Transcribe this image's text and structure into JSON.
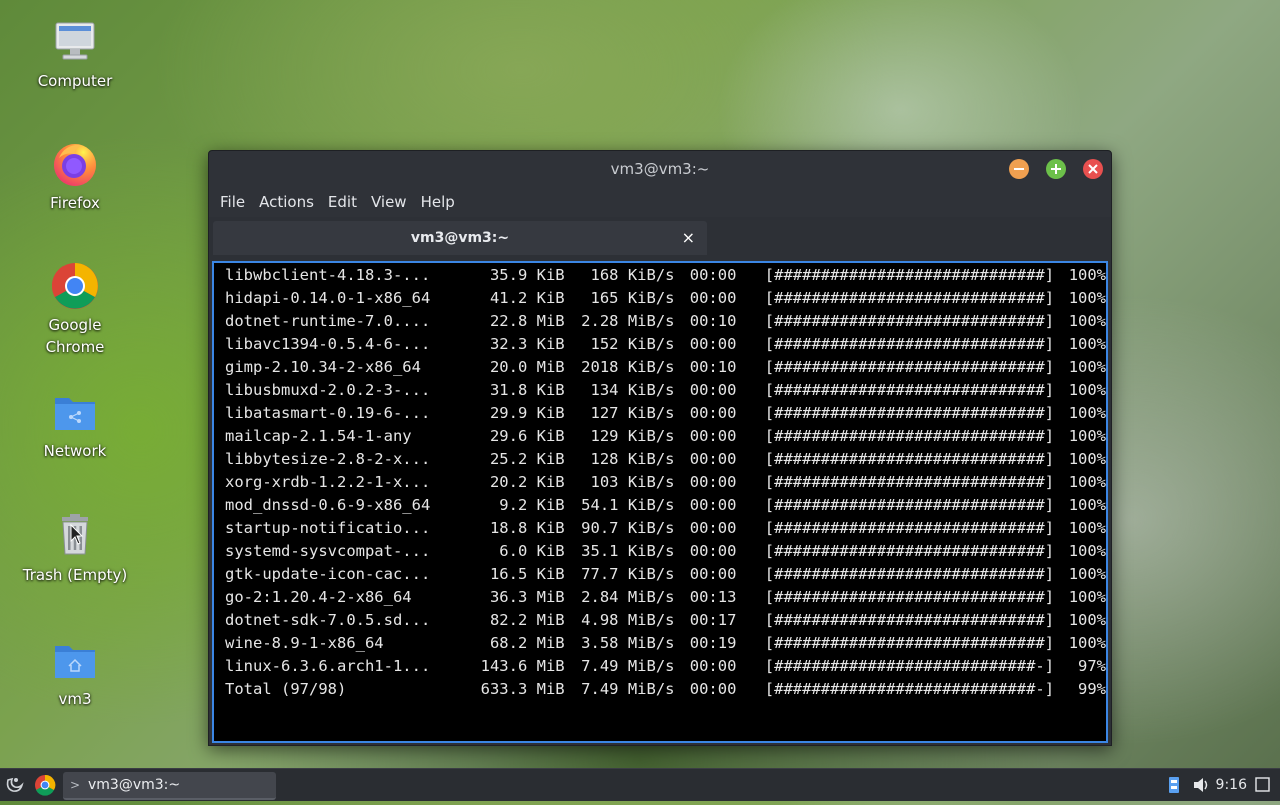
{
  "desktop": {
    "icons": [
      {
        "label": "Computer",
        "icon": "computer-icon"
      },
      {
        "label": "Firefox",
        "icon": "firefox-icon"
      },
      {
        "label": "Google Chrome",
        "icon": "chrome-icon"
      },
      {
        "label": "Network",
        "icon": "network-folder-icon"
      },
      {
        "label": "Trash (Empty)",
        "icon": "trash-icon"
      },
      {
        "label": "vm3",
        "icon": "home-folder-icon"
      }
    ]
  },
  "window": {
    "title": "vm3@vm3:~",
    "menu": [
      "File",
      "Actions",
      "Edit",
      "View",
      "Help"
    ],
    "tab": {
      "label": "vm3@vm3:~",
      "close": "×"
    },
    "colors": {
      "minimize": "#f0a050",
      "maximize": "#6cc04a",
      "close": "#e8504f",
      "focus_border": "#3b86e4"
    }
  },
  "terminal": {
    "rows": [
      {
        "name": "libwbclient-4.18.3-...",
        "size": "35.9 KiB",
        "rate": "168 KiB/s",
        "time": "00:00",
        "bar": "[#############################]",
        "pct": "100%"
      },
      {
        "name": "hidapi-0.14.0-1-x86_64",
        "size": "41.2 KiB",
        "rate": "165 KiB/s",
        "time": "00:00",
        "bar": "[#############################]",
        "pct": "100%"
      },
      {
        "name": "dotnet-runtime-7.0....",
        "size": "22.8 MiB",
        "rate": "2.28 MiB/s",
        "time": "00:10",
        "bar": "[#############################]",
        "pct": "100%"
      },
      {
        "name": "libavc1394-0.5.4-6-...",
        "size": "32.3 KiB",
        "rate": "152 KiB/s",
        "time": "00:00",
        "bar": "[#############################]",
        "pct": "100%"
      },
      {
        "name": "gimp-2.10.34-2-x86_64",
        "size": "20.0 MiB",
        "rate": "2018 KiB/s",
        "time": "00:10",
        "bar": "[#############################]",
        "pct": "100%"
      },
      {
        "name": "libusbmuxd-2.0.2-3-...",
        "size": "31.8 KiB",
        "rate": "134 KiB/s",
        "time": "00:00",
        "bar": "[#############################]",
        "pct": "100%"
      },
      {
        "name": "libatasmart-0.19-6-...",
        "size": "29.9 KiB",
        "rate": "127 KiB/s",
        "time": "00:00",
        "bar": "[#############################]",
        "pct": "100%"
      },
      {
        "name": "mailcap-2.1.54-1-any",
        "size": "29.6 KiB",
        "rate": "129 KiB/s",
        "time": "00:00",
        "bar": "[#############################]",
        "pct": "100%"
      },
      {
        "name": "libbytesize-2.8-2-x...",
        "size": "25.2 KiB",
        "rate": "128 KiB/s",
        "time": "00:00",
        "bar": "[#############################]",
        "pct": "100%"
      },
      {
        "name": "xorg-xrdb-1.2.2-1-x...",
        "size": "20.2 KiB",
        "rate": "103 KiB/s",
        "time": "00:00",
        "bar": "[#############################]",
        "pct": "100%"
      },
      {
        "name": "mod_dnssd-0.6-9-x86_64",
        "size": "9.2 KiB",
        "rate": "54.1 KiB/s",
        "time": "00:00",
        "bar": "[#############################]",
        "pct": "100%"
      },
      {
        "name": "startup-notificatio...",
        "size": "18.8 KiB",
        "rate": "90.7 KiB/s",
        "time": "00:00",
        "bar": "[#############################]",
        "pct": "100%"
      },
      {
        "name": "systemd-sysvcompat-...",
        "size": "6.0 KiB",
        "rate": "35.1 KiB/s",
        "time": "00:00",
        "bar": "[#############################]",
        "pct": "100%"
      },
      {
        "name": "gtk-update-icon-cac...",
        "size": "16.5 KiB",
        "rate": "77.7 KiB/s",
        "time": "00:00",
        "bar": "[#############################]",
        "pct": "100%"
      },
      {
        "name": "go-2:1.20.4-2-x86_64",
        "size": "36.3 MiB",
        "rate": "2.84 MiB/s",
        "time": "00:13",
        "bar": "[#############################]",
        "pct": "100%"
      },
      {
        "name": "dotnet-sdk-7.0.5.sd...",
        "size": "82.2 MiB",
        "rate": "4.98 MiB/s",
        "time": "00:17",
        "bar": "[#############################]",
        "pct": "100%"
      },
      {
        "name": "wine-8.9-1-x86_64",
        "size": "68.2 MiB",
        "rate": "3.58 MiB/s",
        "time": "00:19",
        "bar": "[#############################]",
        "pct": "100%"
      },
      {
        "name": "linux-6.3.6.arch1-1...",
        "size": "143.6 MiB",
        "rate": "7.49 MiB/s",
        "time": "00:00",
        "bar": "[############################-]",
        "pct": "97%"
      },
      {
        "name": "Total (97/98)",
        "size": "633.3 MiB",
        "rate": "7.49 MiB/s",
        "time": "00:00",
        "bar": "[############################-]",
        "pct": "99%"
      }
    ]
  },
  "taskbar": {
    "task_label": "vm3@vm3:~",
    "clock": "9:16"
  }
}
